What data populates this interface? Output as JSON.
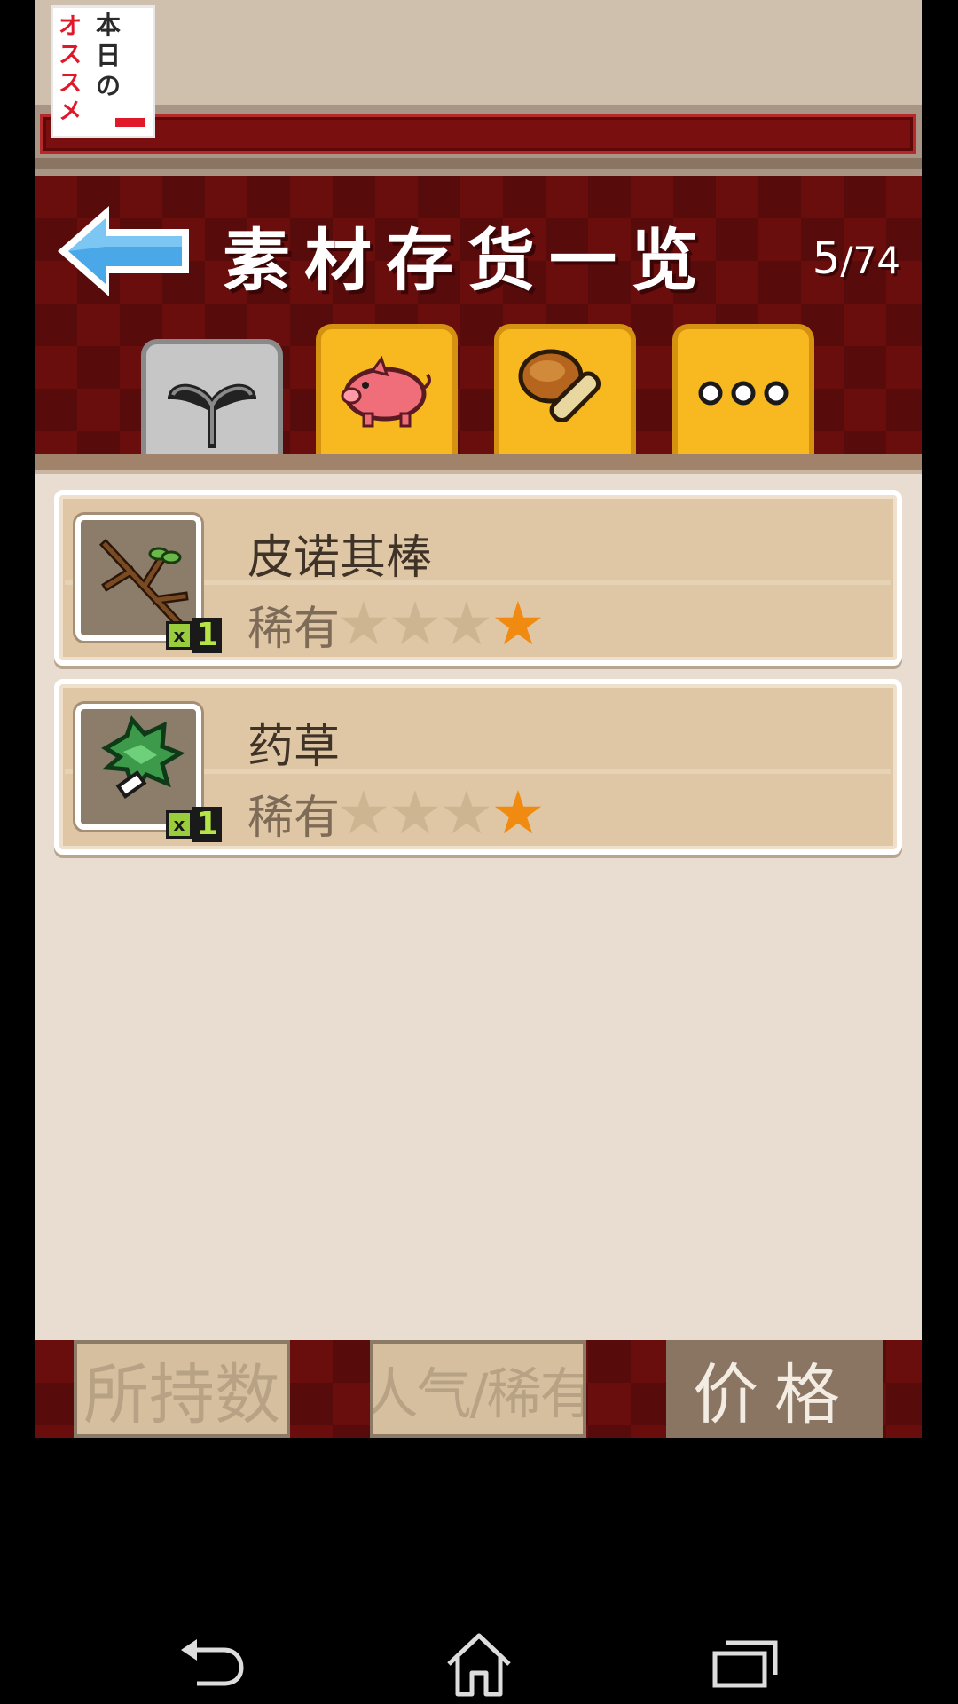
{
  "banner": {
    "ad_text_red": [
      "オ",
      "ス",
      "ス",
      "メ"
    ],
    "ad_text_dark": [
      "本",
      "日",
      "の"
    ]
  },
  "header": {
    "title": "素材存货一览",
    "count_current": "5",
    "count_total": "/74"
  },
  "tabs": [
    {
      "icon": "sprout-icon",
      "active": true
    },
    {
      "icon": "pig-icon",
      "active": false
    },
    {
      "icon": "bread-icon",
      "active": false
    },
    {
      "icon": "more-dots-icon",
      "active": false
    }
  ],
  "items": [
    {
      "name": "皮诺其棒",
      "rarity_label": "稀有",
      "rarity": 1,
      "rarity_max": 4,
      "qty_prefix": "x",
      "qty": "1",
      "icon": "branch-icon"
    },
    {
      "name": "药草",
      "rarity_label": "稀有",
      "rarity": 1,
      "rarity_max": 4,
      "qty_prefix": "x",
      "qty": "1",
      "icon": "herb-icon"
    }
  ],
  "sort": {
    "by_count": "所持数",
    "by_popularity": "人气/稀有",
    "by_price": "价格",
    "active": "by_price"
  },
  "colors": {
    "star_on": "#f08a10",
    "star_off": "#cdb592",
    "header_red": "#6a0d0d"
  }
}
